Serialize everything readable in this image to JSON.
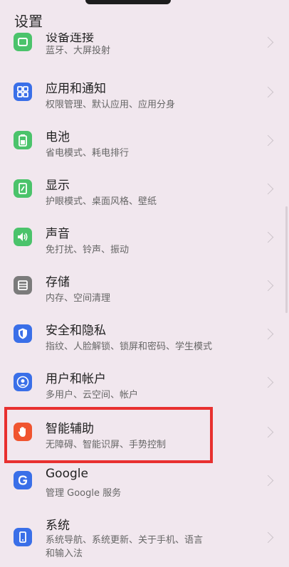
{
  "header": {
    "title": "设置"
  },
  "items": [
    {
      "label": "设备连接",
      "sub": "蓝牙、大屏投射",
      "color": "#4bc36b",
      "icon": "device-connect-icon"
    },
    {
      "label": "应用和通知",
      "sub": "权限管理、默认应用、应用分身",
      "color": "#3a6fe8",
      "icon": "apps-grid-icon"
    },
    {
      "label": "电池",
      "sub": "省电模式、耗电排行",
      "color": "#4bc36b",
      "icon": "battery-icon"
    },
    {
      "label": "显示",
      "sub": "护眼模式、桌面风格、壁纸",
      "color": "#4bc36b",
      "icon": "display-icon"
    },
    {
      "label": "声音",
      "sub": "免打扰、铃声、振动",
      "color": "#4bc36b",
      "icon": "speaker-icon"
    },
    {
      "label": "存储",
      "sub": "内存、空间清理",
      "color": "#7b7b7b",
      "icon": "storage-icon"
    },
    {
      "label": "安全和隐私",
      "sub": "指纹、人脸解锁、锁屏和密码、学生模式",
      "color": "#3a6fe8",
      "icon": "shield-icon"
    },
    {
      "label": "用户和帐户",
      "sub": "多用户、云空间、帐户",
      "color": "#3a6fe8",
      "icon": "user-icon"
    },
    {
      "label": "智能辅助",
      "sub": "无障碍、智能识屏、手势控制",
      "color": "#f0542f",
      "icon": "hand-icon"
    },
    {
      "label": "Google",
      "sub": "管理 Google 服务",
      "color": "#3a6fe8",
      "icon": "google-icon"
    },
    {
      "label": "系统",
      "sub": "系统导航、系统更新、关于手机、语言\n和输入法",
      "color": "#3a6fe8",
      "icon": "phone-icon"
    }
  ]
}
